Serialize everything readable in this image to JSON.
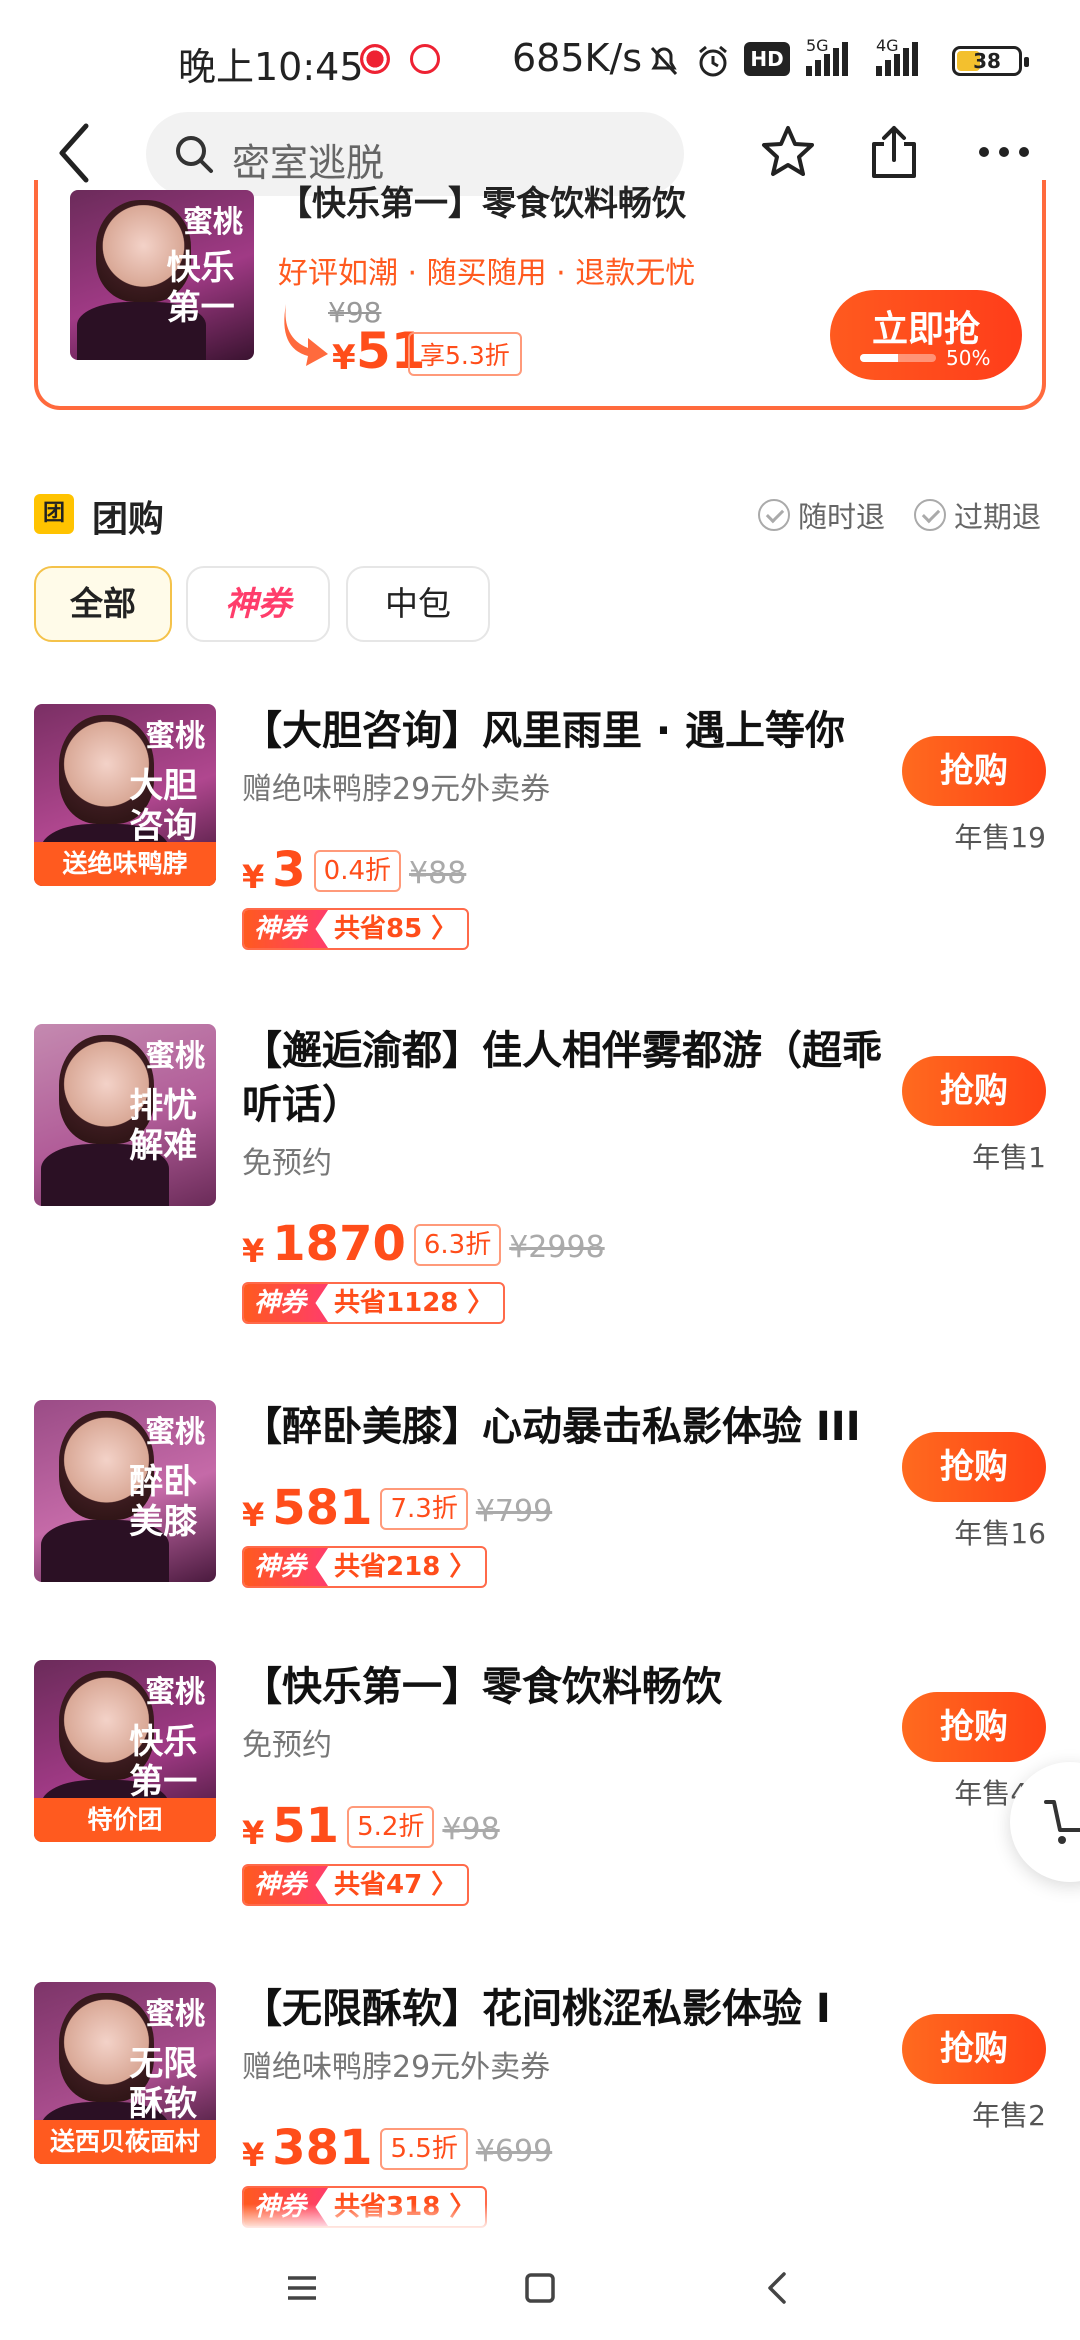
{
  "status_bar": {
    "time": "晚上10:45",
    "net_speed": "685K/s",
    "hd_label": "HD",
    "signal_1_label": "5G",
    "signal_2_label": "4G",
    "battery": "38",
    "battery_level": 0.38
  },
  "search": {
    "query": "密室逃脱"
  },
  "promo": {
    "title": "【快乐第一】零食饮料畅饮",
    "tags": "好评如潮 · 随买随用 · 退款无忧",
    "original_price": "¥98",
    "currency": "¥",
    "price": "51",
    "discount": "享5.3折",
    "buy_label": "立即抢",
    "progress_label": "50%",
    "progress": 0.5,
    "thumb_brand": "蜜桃",
    "thumb_slogan": "快乐第一"
  },
  "section": {
    "icon_text": "团",
    "title": "团购",
    "guarantees": [
      "随时退",
      "过期退"
    ]
  },
  "filters": [
    {
      "label": "全部",
      "active": true
    },
    {
      "label": "神券",
      "active": false
    },
    {
      "label": "中包",
      "active": false
    }
  ],
  "deals": [
    {
      "title": "【大胆咨询】风里雨里 · 遇上等你",
      "subtitle": "赠绝味鸭脖29元外卖券",
      "currency": "¥",
      "price": "3",
      "discount": "0.4折",
      "original_price": "¥88",
      "coupon_tag": "神券",
      "coupon_save": "共省85 〉",
      "button": "抢购",
      "sales": "年售19",
      "thumb_brand": "蜜桃",
      "thumb_slogan": "大胆咨询",
      "thumb_ribbon": "送绝味鸭脖"
    },
    {
      "title": "【邂逅渝都】佳人相伴雾都游（超乖听话）",
      "subtitle": "免预约",
      "currency": "¥",
      "price": "1870",
      "discount": "6.3折",
      "original_price": "¥2998",
      "coupon_tag": "神券",
      "coupon_save": "共省1128 〉",
      "button": "抢购",
      "sales": "年售1",
      "thumb_brand": "蜜桃",
      "thumb_slogan": "排忧解难",
      "thumb_ribbon": ""
    },
    {
      "title": "【醉卧美膝】心动暴击私影体验 III",
      "subtitle": "",
      "currency": "¥",
      "price": "581",
      "discount": "7.3折",
      "original_price": "¥799",
      "coupon_tag": "神券",
      "coupon_save": "共省218 〉",
      "button": "抢购",
      "sales": "年售16",
      "thumb_brand": "蜜桃",
      "thumb_slogan": "醉卧美膝",
      "thumb_ribbon": ""
    },
    {
      "title": "【快乐第一】零食饮料畅饮",
      "subtitle": "免预约",
      "currency": "¥",
      "price": "51",
      "discount": "5.2折",
      "original_price": "¥98",
      "coupon_tag": "神券",
      "coupon_save": "共省47 〉",
      "button": "抢购",
      "sales": "年售49",
      "thumb_brand": "蜜桃",
      "thumb_slogan": "快乐第一",
      "thumb_ribbon": "特价团"
    },
    {
      "title": "【无限酥软】花间桃涩私影体验 I",
      "subtitle": "赠绝味鸭脖29元外卖券",
      "currency": "¥",
      "price": "381",
      "discount": "5.5折",
      "original_price": "¥699",
      "coupon_tag": "神券",
      "coupon_save": "共省318 〉",
      "button": "抢购",
      "sales": "年售2",
      "thumb_brand": "蜜桃",
      "thumb_slogan": "无限酥软",
      "thumb_ribbon": "送西贝莜面村"
    }
  ],
  "colors": {
    "accent": "#ff4d1a",
    "chip_active_border": "#f4c24a",
    "coupon_pink": "#ff3d6b",
    "section_icon": "#ffc300"
  }
}
